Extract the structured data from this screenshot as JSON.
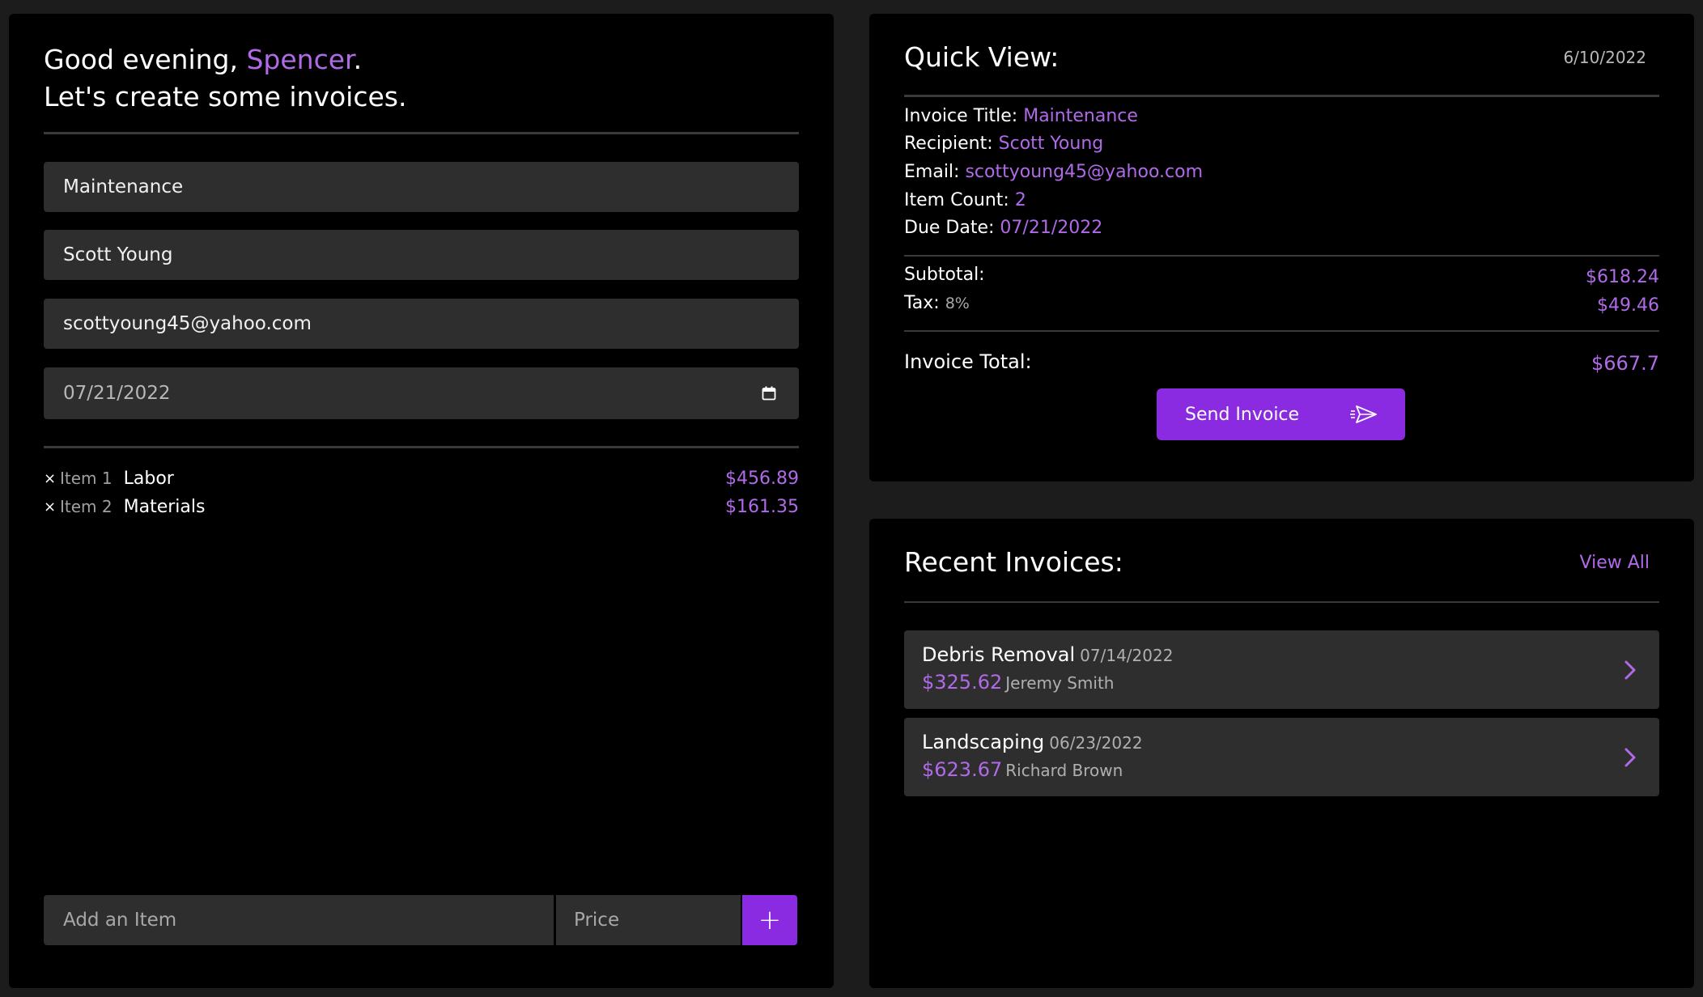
{
  "greeting": {
    "prefix": "Good evening, ",
    "name": "Spencer",
    "suffix": ".",
    "line2": "Let's create some invoices."
  },
  "form": {
    "title_value": "Maintenance",
    "recipient_value": "Scott Young",
    "email_value": "scottyoung45@yahoo.com",
    "due_date_value": "07/21/2022"
  },
  "items": [
    {
      "remove": "×",
      "label": "Item 1",
      "name": "Labor",
      "price": "$456.89"
    },
    {
      "remove": "×",
      "label": "Item 2",
      "name": "Materials",
      "price": "$161.35"
    }
  ],
  "add_item": {
    "item_placeholder": "Add an Item",
    "price_placeholder": "Price",
    "add_label": "+"
  },
  "quick_view": {
    "title": "Quick View:",
    "date": "6/10/2022",
    "invoice_title_label": "Invoice Title:",
    "invoice_title": "Maintenance",
    "recipient_label": "Recipient:",
    "recipient": "Scott Young",
    "email_label": "Email:",
    "email": "scottyoung45@yahoo.com",
    "item_count_label": "Item Count:",
    "item_count": "2",
    "due_date_label": "Due Date:",
    "due_date": "07/21/2022",
    "subtotal_label": "Subtotal:",
    "subtotal": "$618.24",
    "tax_label": "Tax:",
    "tax_rate": "8%",
    "tax": "$49.46",
    "total_label": "Invoice Total:",
    "total": "$667.7",
    "send_label": "Send Invoice",
    "send_icon": "paper-plane-icon"
  },
  "recent": {
    "title": "Recent Invoices:",
    "view_all": "View All",
    "invoices": [
      {
        "title": "Debris Removal",
        "date": "07/14/2022",
        "amount": "$325.62",
        "recipient": "Jeremy Smith"
      },
      {
        "title": "Landscaping",
        "date": "06/23/2022",
        "amount": "$623.67",
        "recipient": "Richard Brown"
      }
    ]
  },
  "colors": {
    "accent": "#8a2be2",
    "accent_text": "#b06ae8",
    "panel": "#000000",
    "field": "#2e2e2e",
    "background": "#1c1c1c"
  }
}
